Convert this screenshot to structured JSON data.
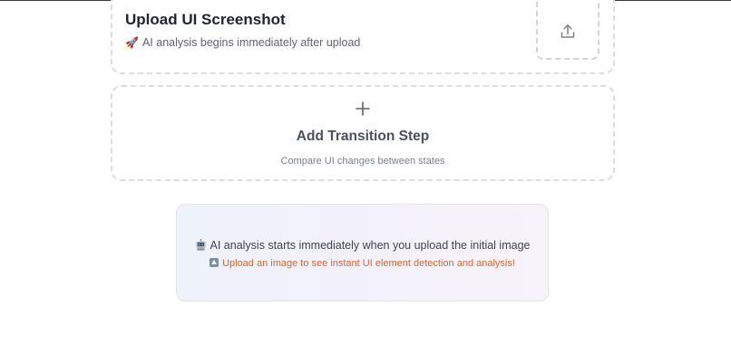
{
  "upload": {
    "title": "Upload UI Screenshot",
    "subtitle_emoji": "🚀",
    "subtitle": "AI analysis begins immediately after upload",
    "dropzone_icon": "upload-icon"
  },
  "add_step": {
    "icon": "plus-icon",
    "title": "Add Transition Step",
    "subtitle": "Compare UI changes between states"
  },
  "info": {
    "icon": "robot-icon",
    "main_text": "AI analysis starts immediately when you upload the initial image",
    "cta_icon": "up-arrow-badge-icon",
    "cta_text": "Upload an image to see instant UI element detection and analysis!",
    "cta_color": "#d9682f"
  }
}
